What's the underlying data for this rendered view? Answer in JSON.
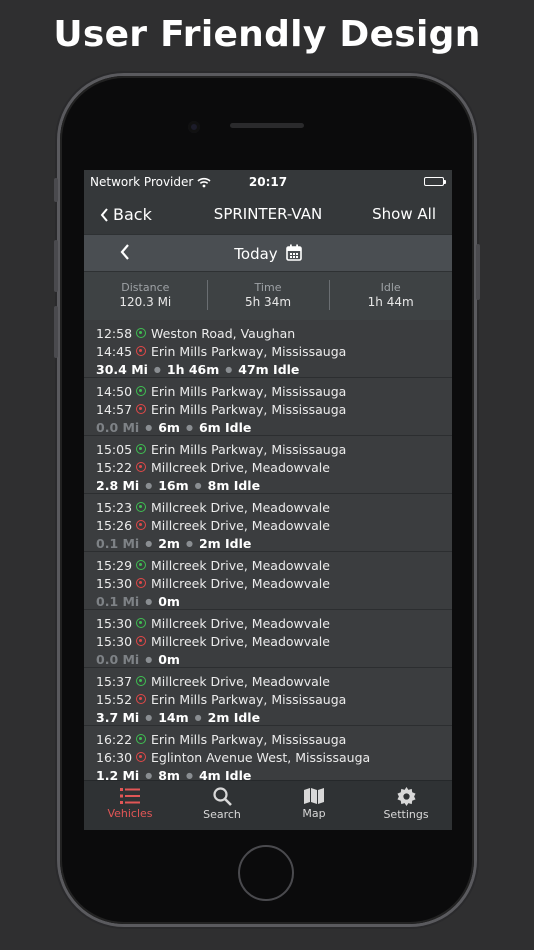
{
  "headline": "User Friendly Design",
  "status": {
    "carrier": "Network Provider",
    "time": "20:17"
  },
  "nav": {
    "back": "Back",
    "title": "SPRINTER-VAN",
    "show_all": "Show All"
  },
  "date": {
    "label": "Today"
  },
  "summary": [
    {
      "label": "Distance",
      "value": "120.3 Mi"
    },
    {
      "label": "Time",
      "value": "5h 34m"
    },
    {
      "label": "Idle",
      "value": "1h 44m"
    }
  ],
  "trips": [
    {
      "start_time": "12:58",
      "start": "Weston Road, Vaughan",
      "end_time": "14:45",
      "end": "Erin Mills Parkway, Mississauga",
      "distance": "30.4 Mi",
      "duration": "1h 46m",
      "idle": "47m Idle"
    },
    {
      "start_time": "14:50",
      "start": "Erin Mills Parkway, Mississauga",
      "end_time": "14:57",
      "end": "Erin Mills Parkway, Mississauga",
      "distance": "0.0 Mi",
      "duration": "6m",
      "idle": "6m Idle"
    },
    {
      "start_time": "15:05",
      "start": "Erin Mills Parkway, Mississauga",
      "end_time": "15:22",
      "end": "Millcreek Drive, Meadowvale",
      "distance": "2.8 Mi",
      "duration": "16m",
      "idle": "8m Idle"
    },
    {
      "start_time": "15:23",
      "start": "Millcreek Drive, Meadowvale",
      "end_time": "15:26",
      "end": "Millcreek Drive, Meadowvale",
      "distance": "0.1 Mi",
      "duration": "2m",
      "idle": "2m Idle"
    },
    {
      "start_time": "15:29",
      "start": "Millcreek Drive, Meadowvale",
      "end_time": "15:30",
      "end": "Millcreek Drive, Meadowvale",
      "distance": "0.1 Mi",
      "duration": "0m",
      "idle": ""
    },
    {
      "start_time": "15:30",
      "start": "Millcreek Drive, Meadowvale",
      "end_time": "15:30",
      "end": "Millcreek Drive, Meadowvale",
      "distance": "0.0 Mi",
      "duration": "0m",
      "idle": ""
    },
    {
      "start_time": "15:37",
      "start": "Millcreek Drive, Meadowvale",
      "end_time": "15:52",
      "end": "Erin Mills Parkway, Mississauga",
      "distance": "3.7 Mi",
      "duration": "14m",
      "idle": "2m Idle"
    },
    {
      "start_time": "16:22",
      "start": "Erin Mills Parkway, Mississauga",
      "end_time": "16:30",
      "end": "Eglinton Avenue West, Mississauga",
      "distance": "1.2 Mi",
      "duration": "8m",
      "idle": "4m Idle"
    }
  ],
  "tabs": [
    {
      "label": "Vehicles",
      "icon": "list-icon",
      "active": true
    },
    {
      "label": "Search",
      "icon": "search-icon",
      "active": false
    },
    {
      "label": "Map",
      "icon": "map-icon",
      "active": false
    },
    {
      "label": "Settings",
      "icon": "gear-icon",
      "active": false
    }
  ],
  "colors": {
    "accent": "#e25656",
    "start": "#3fbf52",
    "end": "#e24848",
    "screen_bg": "#3b3d3f"
  }
}
